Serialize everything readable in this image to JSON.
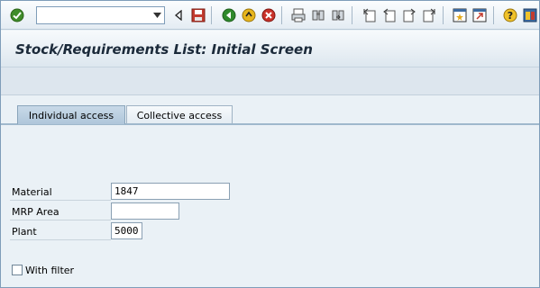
{
  "toolbar": {
    "command_field": {
      "value": "",
      "placeholder": ""
    },
    "icons": [
      "enter-icon",
      "back-triangle-icon",
      "save-icon",
      "back-icon",
      "exit-icon",
      "cancel-icon",
      "print-icon",
      "find-icon",
      "find-next-icon",
      "first-page-icon",
      "previous-page-icon",
      "next-page-icon",
      "last-page-icon",
      "create-session-icon",
      "shortcut-icon",
      "help-icon",
      "layout-icon"
    ]
  },
  "title": "Stock/Requirements List: Initial Screen",
  "tabs": [
    {
      "label": "Individual access",
      "active": true
    },
    {
      "label": "Collective access",
      "active": false
    }
  ],
  "form": {
    "material": {
      "label": "Material",
      "value": "1847"
    },
    "mrp_area": {
      "label": "MRP Area",
      "value": ""
    },
    "plant": {
      "label": "Plant",
      "value": "5000"
    },
    "with_filter": {
      "label": "With filter",
      "checked": false
    }
  },
  "colors": {
    "title_text": "#1b2a3a",
    "tab_active": "#b8cde0",
    "background": "#eaf1f6"
  }
}
